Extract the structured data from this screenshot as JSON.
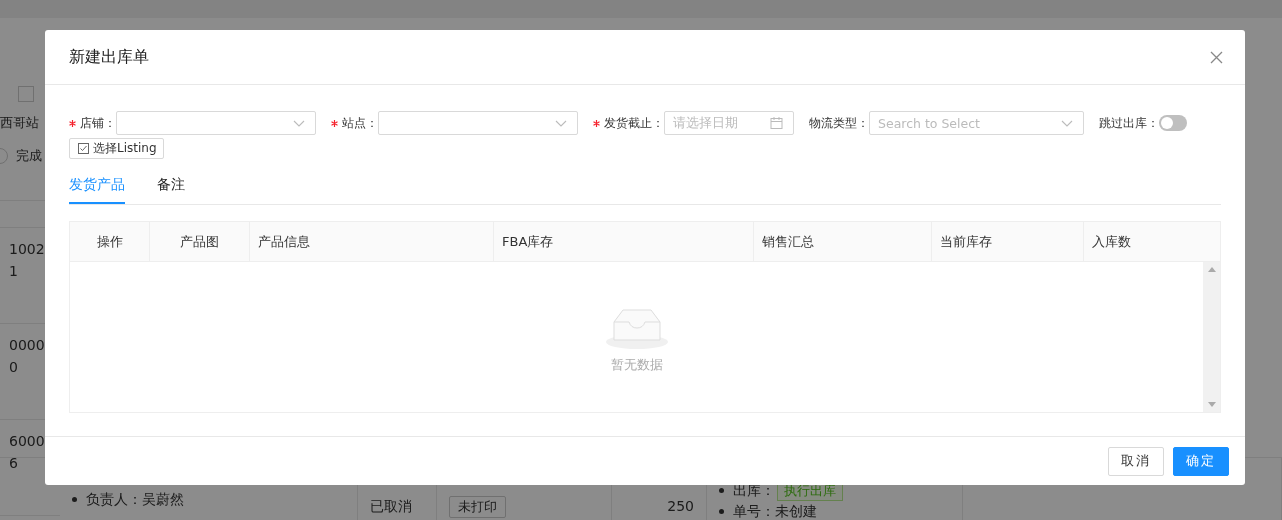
{
  "background": {
    "filter_checkbox": {
      "checked": false
    },
    "site_label": "西哥站",
    "status_radio": {
      "label": "完成",
      "selected": false
    },
    "left_cells": [
      [
        "1002",
        "1"
      ],
      [
        "0000",
        "0"
      ],
      [
        "6000",
        "6"
      ]
    ],
    "bottom_row": {
      "owner": "负责人：吴蔚然",
      "status": "已取消",
      "print_button": "未打印",
      "quantity": "250",
      "outbound_label": "出库：",
      "outbound_tag": "执行出库",
      "order_number": "单号：未创建"
    }
  },
  "dialog": {
    "title": "新建出库单",
    "fields": [
      {
        "kind": "select",
        "label": "店铺：",
        "required": true
      },
      {
        "kind": "select",
        "label": "站点：",
        "required": true
      },
      {
        "kind": "date",
        "label": "发货截止：",
        "required": true,
        "placeholder": "请选择日期"
      },
      {
        "kind": "select",
        "label": "物流类型：",
        "required": false,
        "placeholder": "Search to Select"
      },
      {
        "kind": "switch",
        "label": "跳过出库：",
        "required": false,
        "on": false
      }
    ],
    "listing_button": "选择Listing",
    "tabs": [
      {
        "label": "发货产品",
        "selected": true
      },
      {
        "label": "备注",
        "selected": false
      }
    ],
    "table": {
      "columns": [
        "操作",
        "产品图",
        "产品信息",
        "FBA库存",
        "销售汇总",
        "当前库存",
        "入库数"
      ],
      "empty_text": "暂无数据"
    },
    "buttons": [
      {
        "kind": "default",
        "label": "取消"
      },
      {
        "kind": "primary",
        "label": "确定"
      }
    ]
  }
}
